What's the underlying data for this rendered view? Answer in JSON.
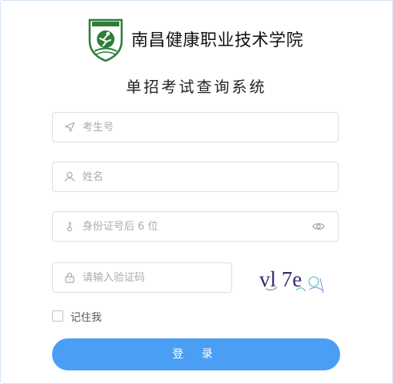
{
  "header": {
    "school_name": "南昌健康职业技术学院",
    "logo_icon": "school-emblem-icon"
  },
  "title": "单招考试查询系统",
  "form": {
    "exam_no": {
      "placeholder": "考生号",
      "icon": "navigation-arrow-icon"
    },
    "name": {
      "placeholder": "姓名",
      "icon": "user-icon"
    },
    "id_last6": {
      "placeholder": "身份证号后 6 位",
      "icon": "key-icon",
      "toggle_icon": "eye-icon"
    },
    "captcha": {
      "placeholder": "请输入验证码",
      "icon": "lock-icon",
      "image_text": "vl 7e"
    },
    "remember_label": "记住我",
    "login_label": "登 录"
  },
  "colors": {
    "accent": "#4a9ff5",
    "logo_green": "#2e7d3a"
  }
}
